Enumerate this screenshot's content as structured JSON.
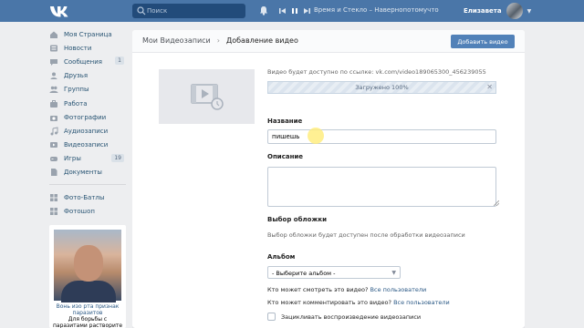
{
  "header": {
    "search_placeholder": "Поиск",
    "track": "Время и Стекло – Навернопотомучто",
    "user_name": "Елизавета"
  },
  "sidebar": {
    "items": [
      {
        "label": "Моя Страница",
        "icon": "home-icon",
        "count": ""
      },
      {
        "label": "Новости",
        "icon": "news-icon",
        "count": ""
      },
      {
        "label": "Сообщения",
        "icon": "messages-icon",
        "count": "1"
      },
      {
        "label": "Друзья",
        "icon": "friends-icon",
        "count": ""
      },
      {
        "label": "Группы",
        "icon": "groups-icon",
        "count": ""
      },
      {
        "label": "Работа",
        "icon": "briefcase-icon",
        "count": ""
      },
      {
        "label": "Фотографии",
        "icon": "camera-icon",
        "count": ""
      },
      {
        "label": "Аудиозаписи",
        "icon": "music-icon",
        "count": ""
      },
      {
        "label": "Видеозаписи",
        "icon": "video-icon",
        "count": ""
      },
      {
        "label": "Игры",
        "icon": "gamepad-icon",
        "count": "19"
      },
      {
        "label": "Документы",
        "icon": "document-icon",
        "count": ""
      }
    ],
    "apps": [
      {
        "label": "Фото-Батлы",
        "icon": "app-icon"
      },
      {
        "label": "Фотошоп",
        "icon": "app-icon"
      }
    ],
    "ad": {
      "title": "Вонь изо рта признак паразитов",
      "text": "Для борьбы с паразитами растворите в воде 2 капли"
    }
  },
  "main": {
    "breadcrumb": {
      "parent": "Мои Видеозаписи",
      "current": "Добавление видео"
    },
    "add_button": "Добавить видео",
    "url_text": "Видео будет доступно по ссылке: vk.com/video189065300_456239055",
    "upload_status": "Загружено 100%",
    "upload_progress": 1.0,
    "name_label": "Название",
    "name_value": "пишешь",
    "description_label": "Описание",
    "description_value": "",
    "cover_label": "Выбор обложки",
    "cover_hint": "Выбор обложки будет доступен после обработки видеозаписи",
    "album_label": "Альбом",
    "album_value": "- Выберите альбом -",
    "view_question": "Кто может смотреть это видео?",
    "view_value": "Все пользователи",
    "comment_question": "Кто может комментировать это видео?",
    "comment_value": "Все пользователи",
    "loop_label": "Зацикливать воспроизведение видеозаписи",
    "loop_checked": false
  },
  "colors": {
    "header_bg": "#4a76a8",
    "accent": "#5181b8",
    "link": "#2a5885",
    "page_bg": "#edeef0"
  }
}
